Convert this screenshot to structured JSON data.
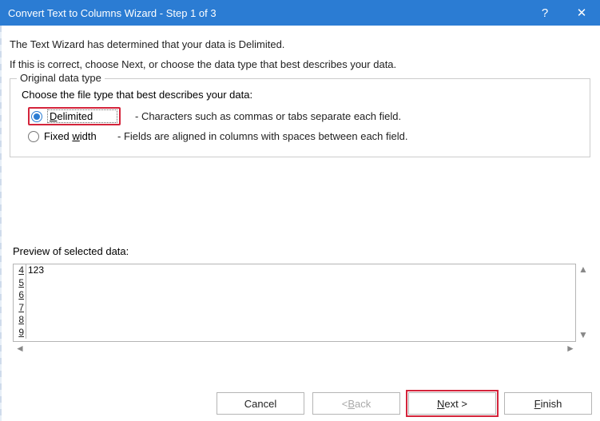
{
  "titlebar": {
    "title": "Convert Text to Columns Wizard - Step 1 of 3",
    "help": "?",
    "close": "✕"
  },
  "intro": {
    "line1": "The Text Wizard has determined that your data is Delimited.",
    "line2": "If this is correct, choose Next, or choose the data type that best describes your data."
  },
  "fieldset": {
    "legend": "Original data type",
    "choose": "Choose the file type that best describes your data:",
    "delimited": {
      "pre": "D",
      "rest": "elimited",
      "desc": "- Characters such as commas or tabs separate each field."
    },
    "fixed": {
      "label": "Fixed ",
      "pre": "w",
      "rest": "idth",
      "desc": "- Fields are aligned in columns with spaces between each field."
    }
  },
  "preview": {
    "label": "Preview of selected data:",
    "rows": [
      {
        "num": "4",
        "val": "123"
      },
      {
        "num": "5",
        "val": ""
      },
      {
        "num": "6",
        "val": ""
      },
      {
        "num": "7",
        "val": ""
      },
      {
        "num": "8",
        "val": ""
      },
      {
        "num": "9",
        "val": ""
      }
    ]
  },
  "buttons": {
    "cancel": "Cancel",
    "back_lt": "< ",
    "back_b": "B",
    "back_rest": "ack",
    "next_n": "N",
    "next_rest": "ext >",
    "finish_f": "F",
    "finish_rest": "inish"
  }
}
